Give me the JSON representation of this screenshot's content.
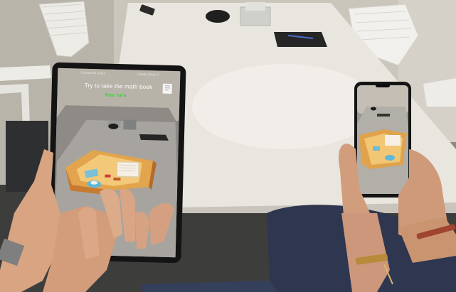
{
  "tablet_screen": {
    "status_left": "Connected Users",
    "status_right": "Ready (User 1)",
    "task_prompt": "Try to take the math book",
    "turn_label": "Your turn"
  },
  "colors": {
    "table_top": "#e8e4dd",
    "floor": "#3b3b3a",
    "wall": "#c9c3b8",
    "skin": "#d9a585",
    "ar_tray": "#e0a24a",
    "ar_tray_wall": "#c8792f",
    "ar_item_blue": "#5db7d8",
    "hud_turn_green": "#3bd23b"
  },
  "icons": [
    "book-icon"
  ]
}
